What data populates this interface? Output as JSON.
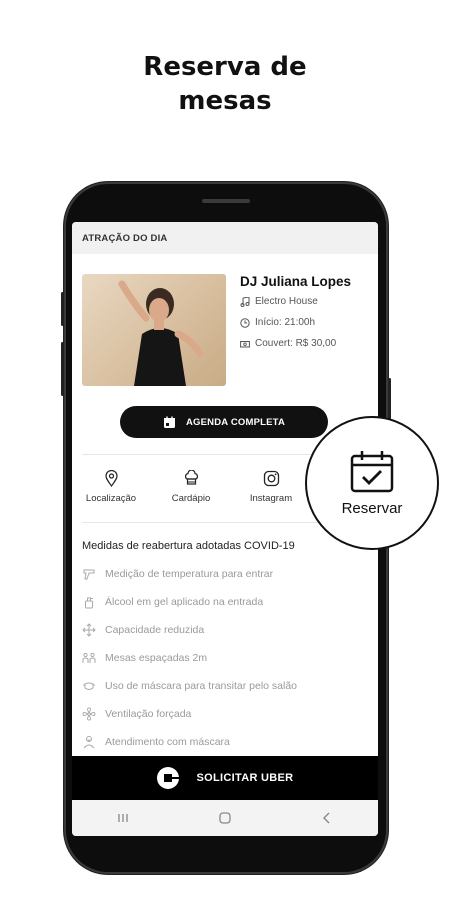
{
  "headline": {
    "line1": "Reserva de",
    "line2": "mesas"
  },
  "section_header": "ATRAÇÃO DO DIA",
  "artist": {
    "name": "DJ Juliana Lopes",
    "genre": "Electro House",
    "start": "Início: 21:00h",
    "couvert": "Couvert: R$ 30,00"
  },
  "agenda_button": "AGENDA COMPLETA",
  "actions": [
    {
      "label": "Localização",
      "icon": "location-pin-icon"
    },
    {
      "label": "Cardápio",
      "icon": "chef-hat-icon"
    },
    {
      "label": "Instagram",
      "icon": "instagram-icon"
    }
  ],
  "reservar": {
    "label": "Reservar",
    "icon": "calendar-check-icon"
  },
  "covid": {
    "title": "Medidas de reabertura adotadas COVID-19",
    "measures": [
      "Medição de temperatura para entrar",
      "Álcool em gel aplicado na entrada",
      "Capacidade reduzida",
      "Mesas espaçadas 2m",
      "Uso de máscara para transitar pelo salão",
      "Ventilação forçada",
      "Atendimento com máscara"
    ]
  },
  "uber_button": "SOLICITAR UBER",
  "colors": {
    "primary": "#111111",
    "muted": "#9a9a9a",
    "header_bg": "#f1f1f1"
  }
}
